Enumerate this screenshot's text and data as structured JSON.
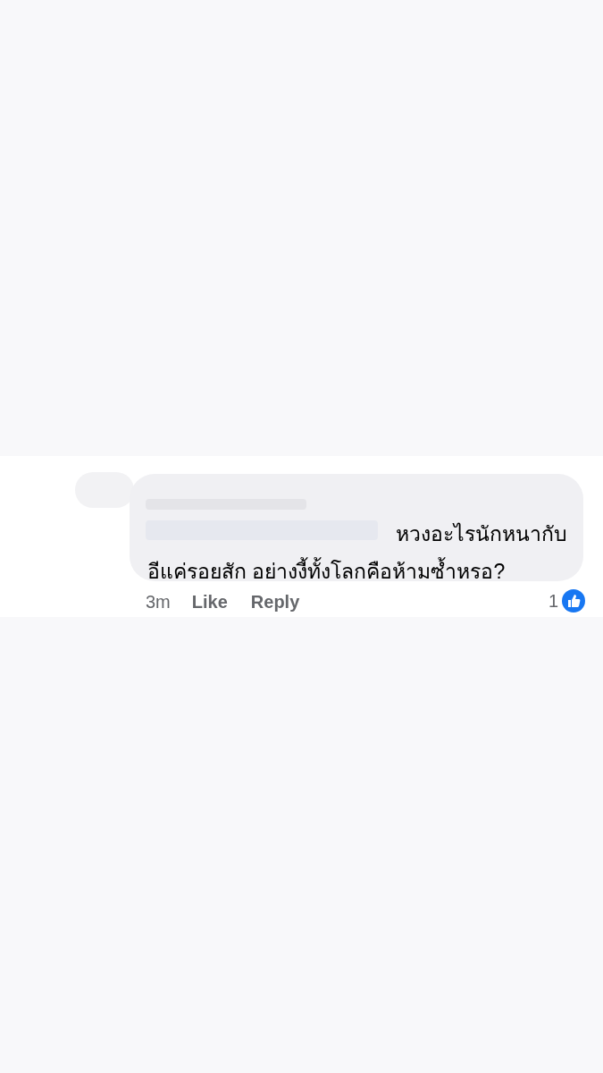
{
  "comment": {
    "text_lines": [
      "หวงอะไรนักหนากับ",
      "อีแค่รอยสัก อย่างงี้ทั้งโลกคือห้ามซ้ำหรอ?"
    ],
    "time": "3m",
    "actions": [
      "Like",
      "Reply"
    ],
    "reaction_count": "1"
  }
}
